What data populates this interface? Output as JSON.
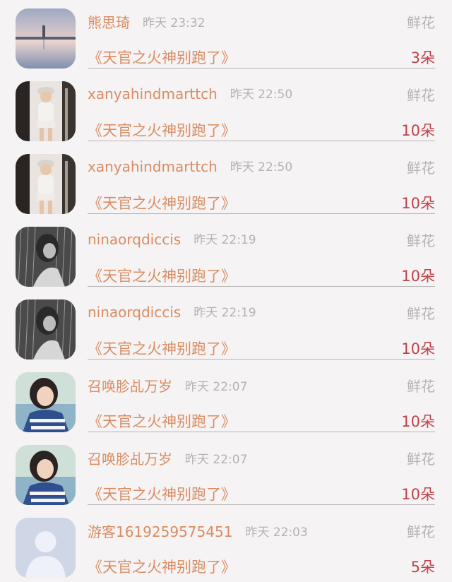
{
  "entries": [
    {
      "user": "熊思琦",
      "time": "昨天 23:32",
      "gift_type": "鲜花",
      "book": "《天官之火神别跑了》",
      "count": "3朵",
      "avatar": "landscape-photo"
    },
    {
      "user": "xanyahindmarttch",
      "time": "昨天 22:50",
      "gift_type": "鲜花",
      "book": "《天官之火神别跑了》",
      "count": "10朵",
      "avatar": "woman-photo"
    },
    {
      "user": "xanyahindmarttch",
      "time": "昨天 22:50",
      "gift_type": "鲜花",
      "book": "《天官之火神别跑了》",
      "count": "10朵",
      "avatar": "woman-photo"
    },
    {
      "user": "ninaorqdiccis",
      "time": "昨天 22:19",
      "gift_type": "鲜花",
      "book": "《天官之火神别跑了》",
      "count": "10朵",
      "avatar": "rain-photo"
    },
    {
      "user": "ninaorqdiccis",
      "time": "昨天 22:19",
      "gift_type": "鲜花",
      "book": "《天官之火神别跑了》",
      "count": "10朵",
      "avatar": "rain-photo"
    },
    {
      "user": "召唤胗乩万岁",
      "time": "昨天 22:07",
      "gift_type": "鲜花",
      "book": "《天官之火神别跑了》",
      "count": "10朵",
      "avatar": "girl-photo"
    },
    {
      "user": "召唤胗乩万岁",
      "time": "昨天 22:07",
      "gift_type": "鲜花",
      "book": "《天官之火神别跑了》",
      "count": "10朵",
      "avatar": "girl-photo"
    },
    {
      "user": "游客1619259575451",
      "time": "昨天 22:03",
      "gift_type": "鲜花",
      "book": "《天官之火神别跑了》",
      "count": "5朵",
      "avatar": "default-user"
    }
  ],
  "colors": {
    "background": "#f5f3f3",
    "name": "#d98c63",
    "time": "#b7b1b1",
    "count": "#c0424b",
    "divider": "#b9b4b4"
  }
}
